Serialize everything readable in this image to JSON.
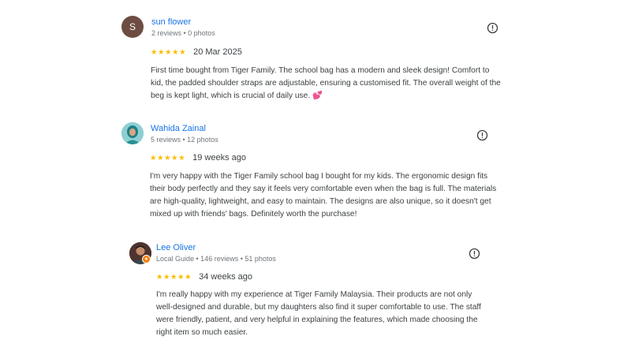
{
  "reviews": [
    {
      "avatar_letter": "S",
      "name": "sun flower",
      "meta": "2 reviews • 0 photos",
      "stars": "★★★★★",
      "rating": 5,
      "date": "20 Mar 2025",
      "text": "First time bought from Tiger Family. The school bag has a modern and sleek design! Comfort to kid, the padded shoulder straps are adjustable, ensuring a customised fit. The overall weight of the beg is kept light, which is crucial of daily use. 💕"
    },
    {
      "name": "Wahida Zainal",
      "meta": "5 reviews • 12 photos",
      "stars": "★★★★★",
      "rating": 5,
      "date": "19 weeks ago",
      "text": "I'm very happy with the Tiger Family school bag I bought for my kids. The ergonomic design fits their body perfectly and they say it feels very comfortable even when the bag is full. The materials are high-quality, lightweight, and easy to maintain. The designs are also unique, so it doesn't get mixed up with friends' bags. Definitely worth the purchase!"
    },
    {
      "name": "Lee Oliver",
      "meta": "Local Guide • 146 reviews • 51 photos",
      "stars": "★★★★★",
      "rating": 5,
      "date": "34 weeks ago",
      "text": "I'm really happy with my experience at Tiger Family Malaysia. Their products are not only well-designed and durable, but my daughters also find it super comfortable to use. The staff were friendly, patient, and very helpful in explaining the features, which made choosing the right item so much easier."
    }
  ]
}
